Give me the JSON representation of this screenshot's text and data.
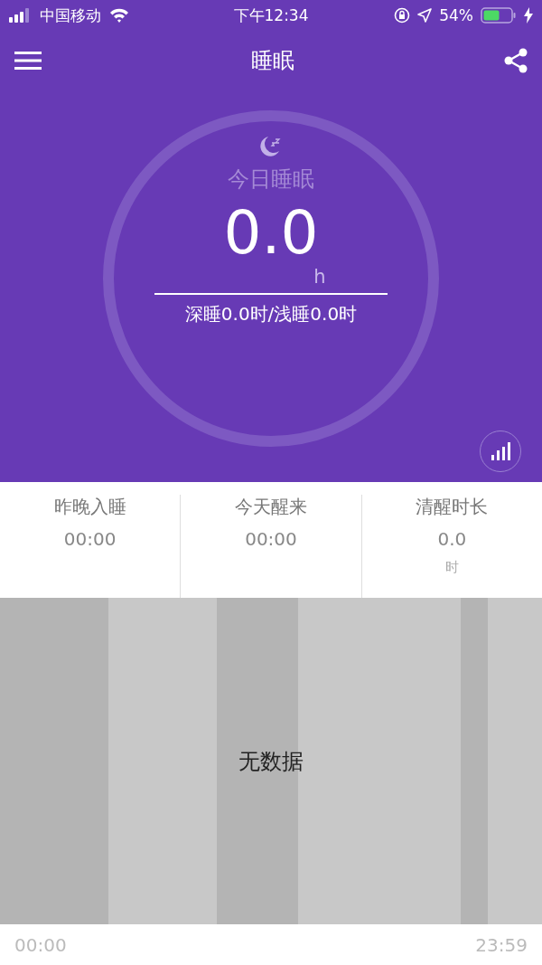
{
  "status_bar": {
    "carrier": "中国移动",
    "time": "下午12:34",
    "battery": "54%"
  },
  "nav": {
    "title": "睡眠"
  },
  "ring": {
    "label": "今日睡眠",
    "value": "0.0",
    "unit": "h",
    "detail": "深睡0.0时/浅睡0.0时"
  },
  "stats": [
    {
      "label": "昨晚入睡",
      "value": "00:00"
    },
    {
      "label": "今天醒来",
      "value": "00:00"
    },
    {
      "label": "清醒时长",
      "value": "0.0",
      "unit": "时"
    }
  ],
  "chart": {
    "empty_text": "无数据",
    "start_time": "00:00",
    "end_time": "23:59"
  }
}
